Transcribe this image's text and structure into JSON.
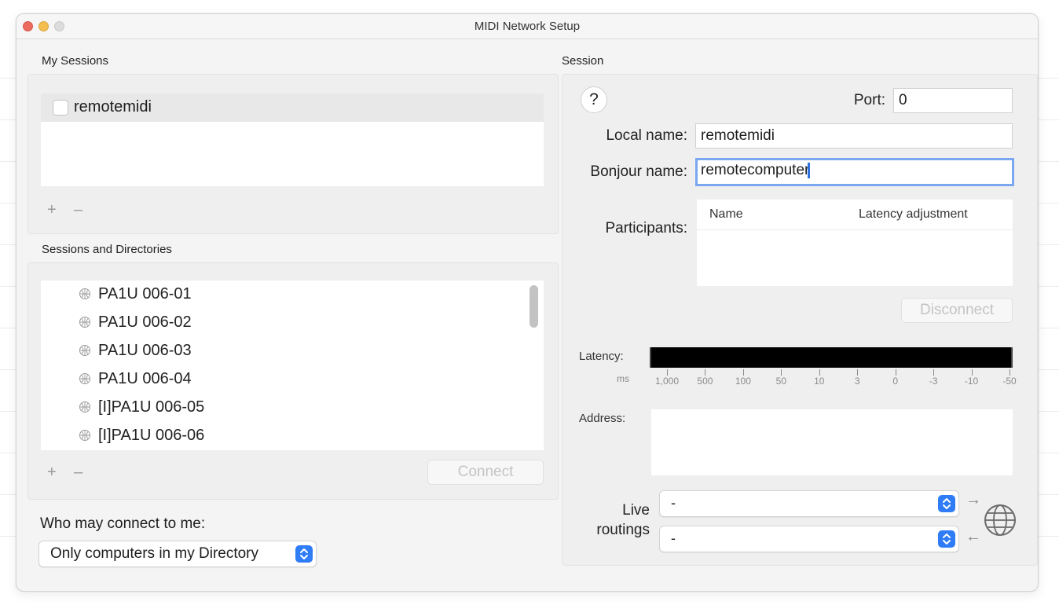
{
  "window": {
    "title": "MIDI Network Setup"
  },
  "my_sessions": {
    "label": "My Sessions",
    "items": [
      {
        "name": "remotemidi",
        "checked": false
      }
    ],
    "add_label": "+",
    "remove_label": "–"
  },
  "directories": {
    "label": "Sessions and Directories",
    "items": [
      {
        "name": "PA1U 006-01",
        "icon": "network-host-icon"
      },
      {
        "name": "PA1U 006-02",
        "icon": "network-host-icon"
      },
      {
        "name": "PA1U 006-03",
        "icon": "network-host-icon"
      },
      {
        "name": "PA1U 006-04",
        "icon": "network-host-icon"
      },
      {
        "name": "[I]PA1U 006-05",
        "icon": "network-host-icon"
      },
      {
        "name": "[I]PA1U 006-06",
        "icon": "network-host-icon"
      }
    ],
    "add_label": "+",
    "remove_label": "–",
    "connect_label": "Connect"
  },
  "who_may_connect": {
    "label": "Who may connect to me:",
    "selected": "Only computers in my Directory"
  },
  "session": {
    "label": "Session",
    "help_label": "?",
    "port_label": "Port:",
    "port_value": "0",
    "local_name_label": "Local name:",
    "local_name_value": "remotemidi",
    "bonjour_name_label": "Bonjour name:",
    "bonjour_name_value": "remotecomputer",
    "participants_label": "Participants:",
    "participants_columns": [
      "Name",
      "Latency adjustment"
    ],
    "disconnect_label": "Disconnect",
    "latency_label": "Latency:",
    "latency_unit": "ms",
    "latency_ticks": [
      "1,000",
      "500",
      "100",
      "50",
      "10",
      "3",
      "0",
      "-3",
      "-10",
      "-50"
    ],
    "address_label": "Address:",
    "live_routings_label_line1": "Live",
    "live_routings_label_line2": "routings",
    "routing_in_value": "-",
    "routing_out_value": "-"
  },
  "colors": {
    "accent": "#2f7cf6",
    "focus_ring": "#7aa7ef",
    "close": "#ed6a5e",
    "minimize": "#f5bf4f"
  }
}
